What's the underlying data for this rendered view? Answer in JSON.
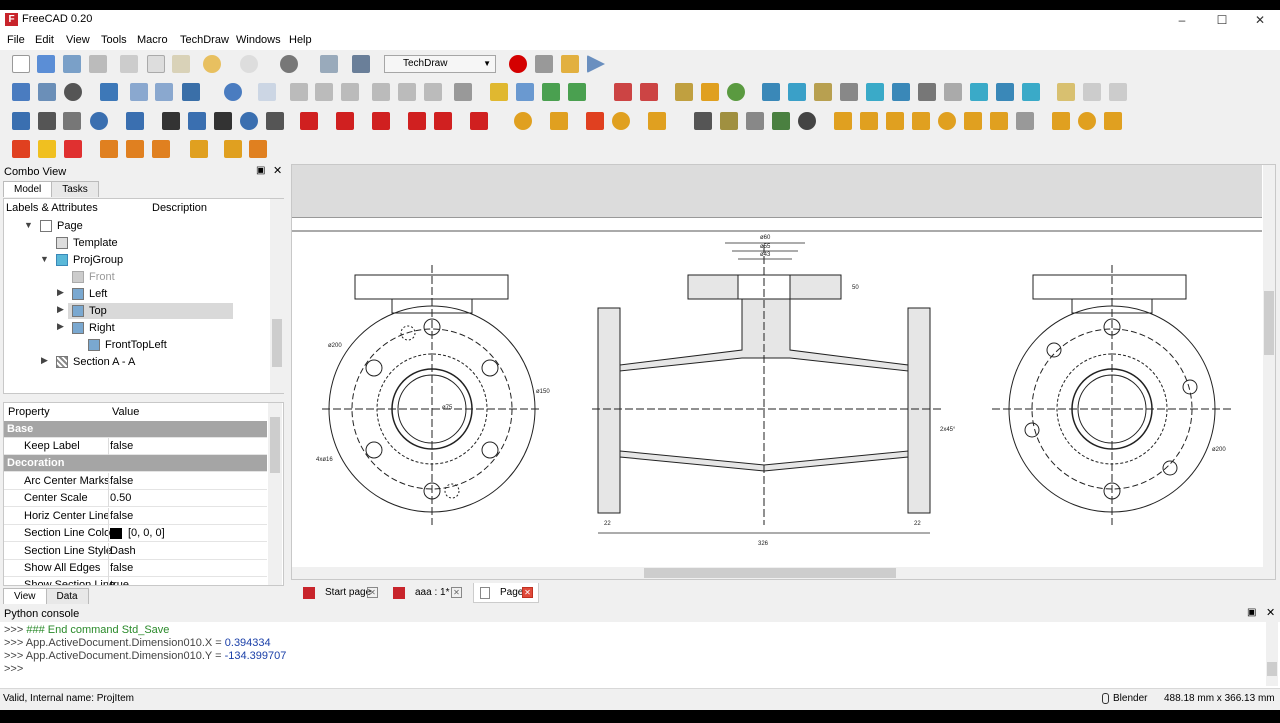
{
  "window": {
    "title": "FreeCAD 0.20",
    "minimize": "–",
    "maximize": "☐",
    "close": "✕"
  },
  "menu": [
    "File",
    "Edit",
    "View",
    "Tools",
    "Macro",
    "TechDraw",
    "Windows",
    "Help"
  ],
  "toolbar": {
    "workbench": "TechDraw"
  },
  "combo": {
    "title": "Combo View",
    "tabs": [
      "Model",
      "Tasks"
    ],
    "tree_headers": [
      "Labels & Attributes",
      "Description"
    ],
    "tree": [
      {
        "label": "Page"
      },
      {
        "label": "Template"
      },
      {
        "label": "ProjGroup"
      },
      {
        "label": "Front"
      },
      {
        "label": "Left"
      },
      {
        "label": "Top"
      },
      {
        "label": "Right"
      },
      {
        "label": "FrontTopLeft"
      },
      {
        "label": "Section A - A"
      }
    ],
    "prop_headers": [
      "Property",
      "Value"
    ],
    "props": [
      {
        "name": "Base",
        "group": true
      },
      {
        "name": "Keep Label",
        "value": "false"
      },
      {
        "name": "Decoration",
        "group": true
      },
      {
        "name": "Arc Center Marks",
        "value": "false"
      },
      {
        "name": "Center Scale",
        "value": "0.50"
      },
      {
        "name": "Horiz Center Line",
        "value": "false"
      },
      {
        "name": "Section Line Color",
        "value": "[0, 0, 0]",
        "swatch": "#000000"
      },
      {
        "name": "Section Line Style",
        "value": "Dash"
      },
      {
        "name": "Show All Edges",
        "value": "false"
      },
      {
        "name": "Show Section Line",
        "value": "true"
      }
    ],
    "bottom_tabs": [
      "View",
      "Data"
    ]
  },
  "drawing": {
    "dims": [
      "ø60",
      "ø55",
      "ø43",
      "326",
      "22",
      "22",
      "50",
      "2x45°",
      "ø150",
      "ø200",
      "ø200",
      "ø75",
      "4xø16"
    ]
  },
  "doc_tabs": [
    "Start page",
    "aaa : 1*",
    "Page*"
  ],
  "console": {
    "title": "Python console",
    "lines": [
      {
        "prompt": ">>> ",
        "text": "### End command Std_Save",
        "kind": "comment"
      },
      {
        "prompt": ">>> ",
        "text": "App.ActiveDocument.Dimension010.X = ",
        "value": "0.394334"
      },
      {
        "prompt": ">>> ",
        "text": "App.ActiveDocument.Dimension010.Y = ",
        "value": "-134.399707"
      },
      {
        "prompt": ">>> ",
        "text": ""
      }
    ]
  },
  "status": {
    "left": "Valid, Internal name: ProjItem",
    "nav": "Blender",
    "size": "488.18 mm x 366.13 mm"
  }
}
